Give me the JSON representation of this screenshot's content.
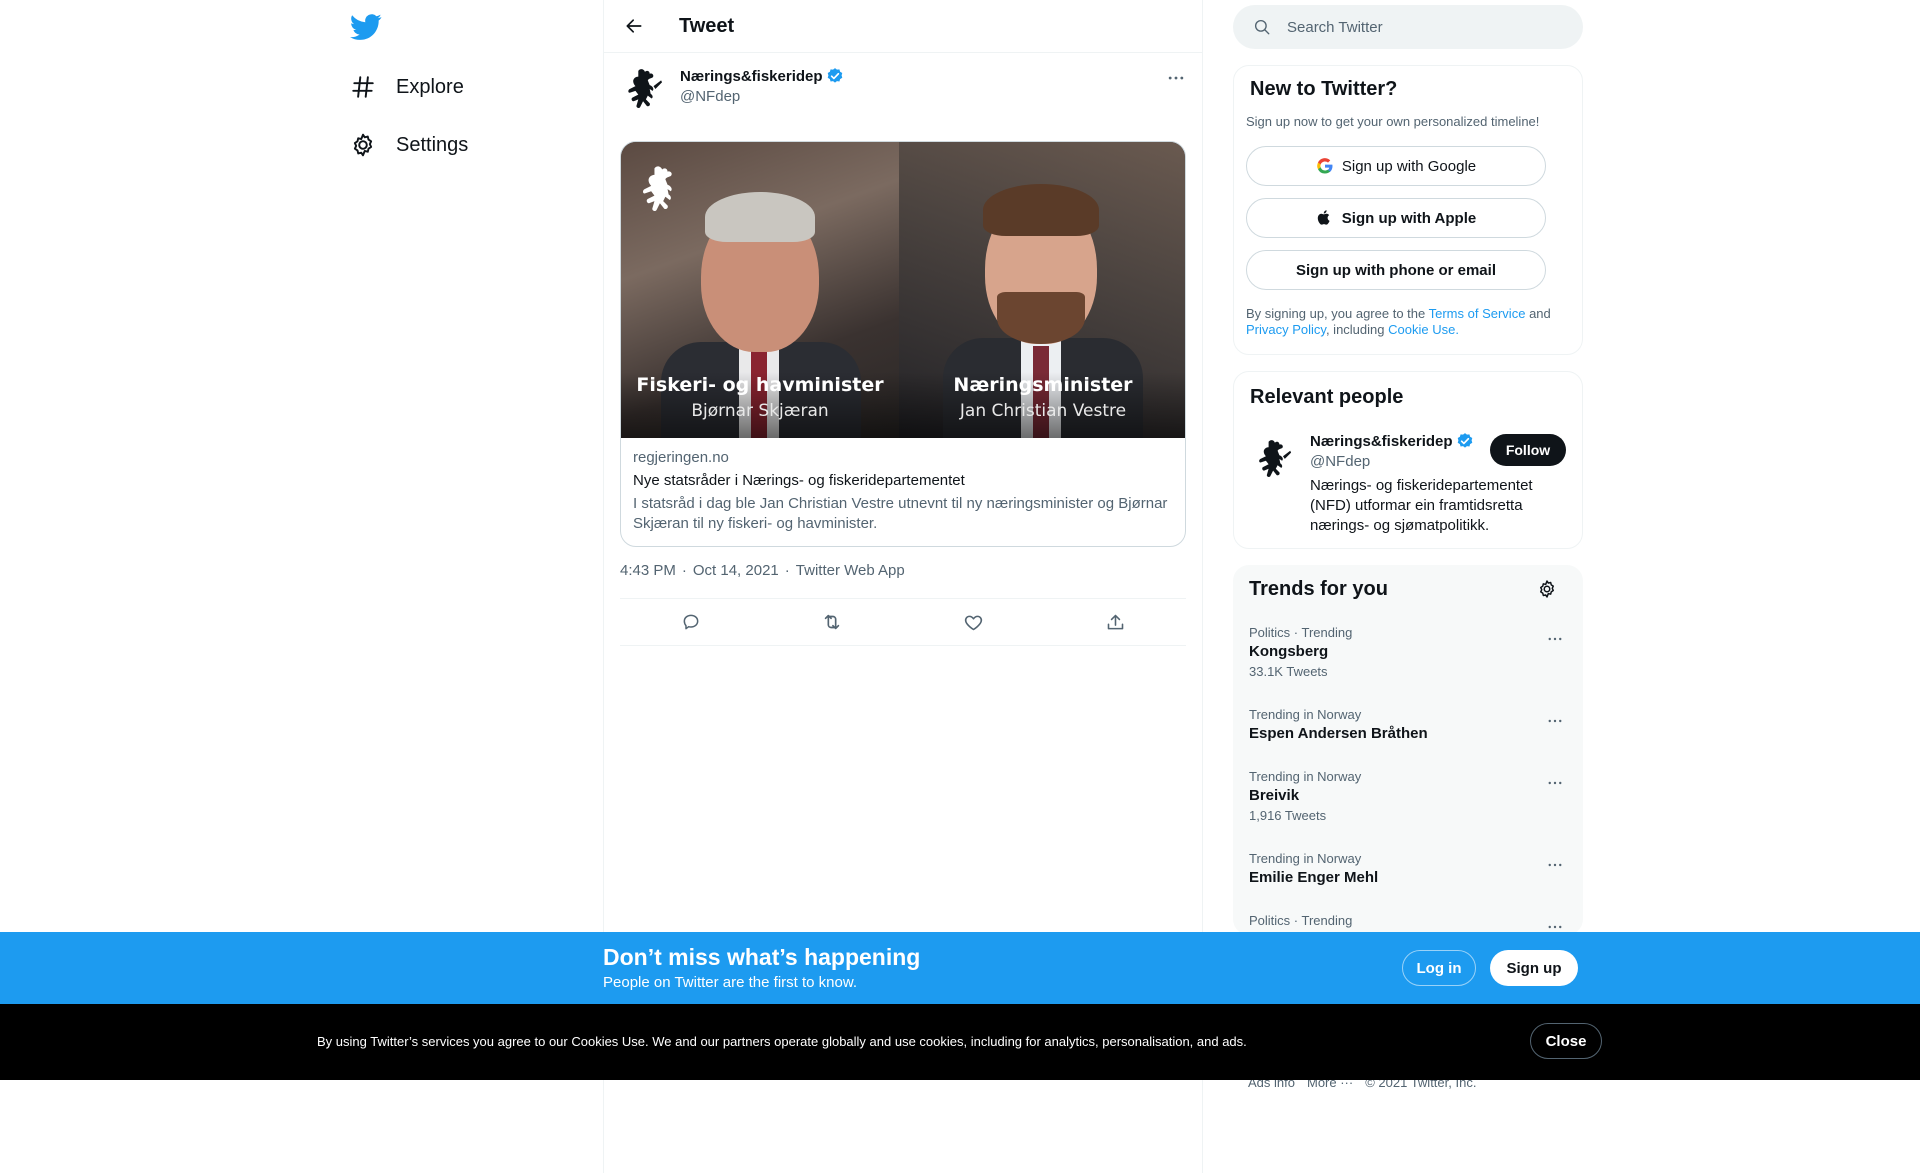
{
  "nav": {
    "items": [
      {
        "label": "Explore",
        "icon": "hashtag-icon"
      },
      {
        "label": "Settings",
        "icon": "gear-icon"
      }
    ]
  },
  "header": {
    "title": "Tweet"
  },
  "tweet": {
    "name": "Nærings&fiskeridep",
    "handle": "@NFdep",
    "card": {
      "left_caption_title": "Fiskeri- og havminister",
      "left_caption_sub": "Bjørnar Skjæran",
      "right_caption_title": "Næringsminister",
      "right_caption_sub": "Jan Christian Vestre",
      "domain": "regjeringen.no",
      "title": "Nye statsråder i Nærings- og fiskeridepartementet",
      "description": "I statsråd i dag ble Jan Christian Vestre utnevnt til ny næringsminister og Bjørnar Skjæran til ny fiskeri- og havminister."
    },
    "time": "4:43 PM",
    "date": "Oct 14, 2021",
    "source": "Twitter Web App",
    "separator": "·"
  },
  "search": {
    "placeholder": "Search Twitter"
  },
  "signup_panel": {
    "title": "New to Twitter?",
    "subtitle": "Sign up now to get your own personalized timeline!",
    "google_label": "Sign up with Google",
    "apple_label": "Sign up with Apple",
    "phone_label": "Sign up with phone or email",
    "terms_prefix": "By signing up, you agree to the",
    "terms_link": "Terms of Service",
    "terms_and": "and",
    "privacy_link": "Privacy Policy",
    "including": ", including",
    "cookie_link": "Cookie Use."
  },
  "relevant_people": {
    "title": "Relevant people",
    "name": "Nærings&fiskeridep",
    "handle": "@NFdep",
    "follow_label": "Follow",
    "bio": "Nærings- og fiskeridepartementet (NFD) utformar ein framtidsretta nærings- og sjømatpolitikk."
  },
  "trends": {
    "title": "Trends for you",
    "items": [
      {
        "meta": "Politics · Trending",
        "name": "Kongsberg",
        "count": "33.1K Tweets"
      },
      {
        "meta": "Trending in Norway",
        "name": "Espen Andersen Bråthen",
        "count": ""
      },
      {
        "meta": "Trending in Norway",
        "name": "Breivik",
        "count": "1,916 Tweets"
      },
      {
        "meta": "Trending in Norway",
        "name": "Emilie Enger Mehl",
        "count": ""
      },
      {
        "meta": "Politics · Trending",
        "name": "",
        "count": ""
      }
    ]
  },
  "banner": {
    "title": "Don’t miss what’s happening",
    "subtitle": "People on Twitter are the first to know.",
    "login_label": "Log in",
    "signup_label": "Sign up"
  },
  "cookie": {
    "text": "By using Twitter’s services you agree to our Cookies Use. We and our partners operate globally and use cookies, including for analytics, personalisation, and ads.",
    "close_label": "Close"
  },
  "footer": {
    "ads": "Ads info",
    "more": "More ···",
    "copyright": "© 2021 Twitter, Inc."
  },
  "colors": {
    "accent": "#1d9bf0",
    "text": "#0f1419",
    "muted": "#536471",
    "border": "#eff3f4"
  }
}
